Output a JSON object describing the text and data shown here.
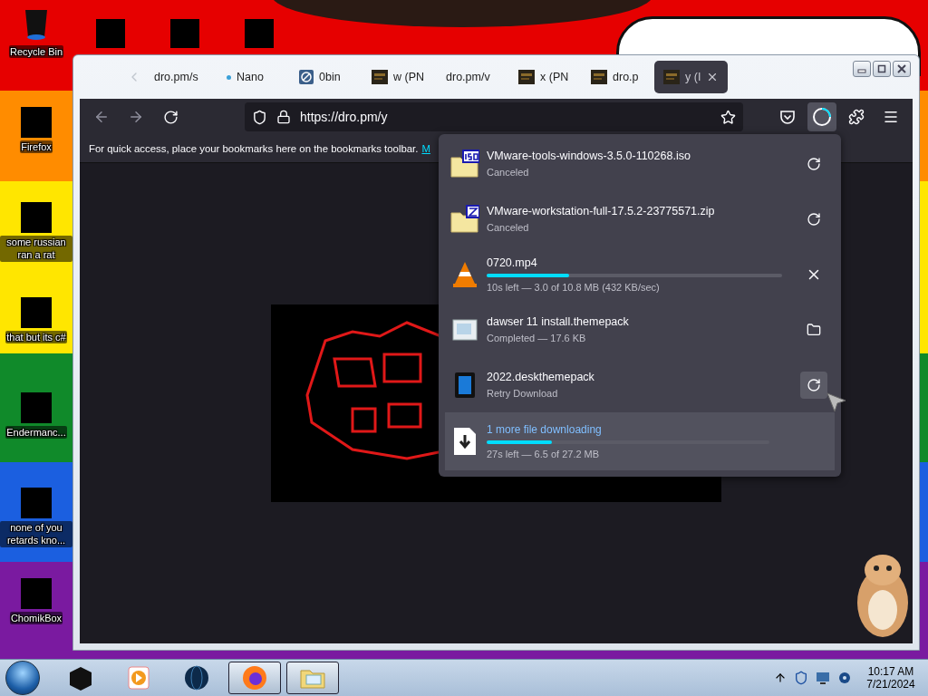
{
  "desktop": {
    "top_icons": [
      {
        "label": "Recycle Bin",
        "kind": "bin"
      },
      {
        "kind": "redacted"
      },
      {
        "kind": "redacted"
      },
      {
        "kind": "redacted"
      }
    ],
    "left_icons": [
      {
        "label": "Firefox"
      },
      {
        "label": "some russian ran a rat"
      },
      {
        "label": "that but its c#"
      },
      {
        "label": "Endermanc..."
      },
      {
        "label": "none of you retards kno..."
      },
      {
        "label": "ChomikBox"
      }
    ]
  },
  "browser": {
    "tabs": [
      {
        "title": "dro.pm/s",
        "kind": "plain",
        "selected": false
      },
      {
        "title": "Nano",
        "kind": "dot",
        "selected": false
      },
      {
        "title": "0bin",
        "kind": "bin",
        "selected": false
      },
      {
        "title": "w (PN",
        "kind": "thumb",
        "selected": false
      },
      {
        "title": "dro.pm/v",
        "kind": "plain",
        "selected": false
      },
      {
        "title": "x (PN",
        "kind": "thumb",
        "selected": false
      },
      {
        "title": "dro.p",
        "kind": "thumb",
        "selected": false
      },
      {
        "title": "y (I",
        "kind": "thumb",
        "selected": true
      }
    ],
    "url": "https://dro.pm/y",
    "downloads_button": {
      "selected": true
    },
    "bookmarks_hint": "For quick access, place your bookmarks here on the bookmarks toolbar.",
    "bookmarks_link": "M",
    "downloads": [
      {
        "kind": "iso",
        "name": "VMware-tools-windows-3.5.0-110268.iso",
        "status": "Canceled",
        "in_progress": false,
        "completed": false,
        "hovered": false
      },
      {
        "kind": "zip",
        "name": "VMware-workstation-full-17.5.2-23775571.zip",
        "status": "Canceled",
        "in_progress": false,
        "completed": false,
        "hovered": false
      },
      {
        "kind": "video",
        "name": "0720.mp4",
        "status": "10s left — 3.0 of 10.8 MB (432 KB/sec)",
        "in_progress": true,
        "completed": false,
        "level": 0.28,
        "hovered": false
      },
      {
        "kind": "theme",
        "name": "dawser 11 install.themepack",
        "status": "Completed — 17.6 KB",
        "in_progress": false,
        "completed": true,
        "hovered": false
      },
      {
        "kind": "desk",
        "name": "2022.deskthemepack",
        "status": "Retry Download",
        "in_progress": false,
        "completed": false,
        "hovered": true
      }
    ],
    "summary": {
      "title": "1 more file downloading",
      "level": 0.23,
      "status": "27s left — 6.5 of 27.2 MB"
    }
  },
  "taskbar": {
    "apps": [
      {
        "kind": "box",
        "running": false
      },
      {
        "kind": "media",
        "running": false
      },
      {
        "kind": "globe",
        "running": false
      },
      {
        "kind": "firefox",
        "running": true
      },
      {
        "kind": "explorer",
        "running": true
      }
    ],
    "time": "10:17 AM",
    "date": "7/21/2024"
  }
}
